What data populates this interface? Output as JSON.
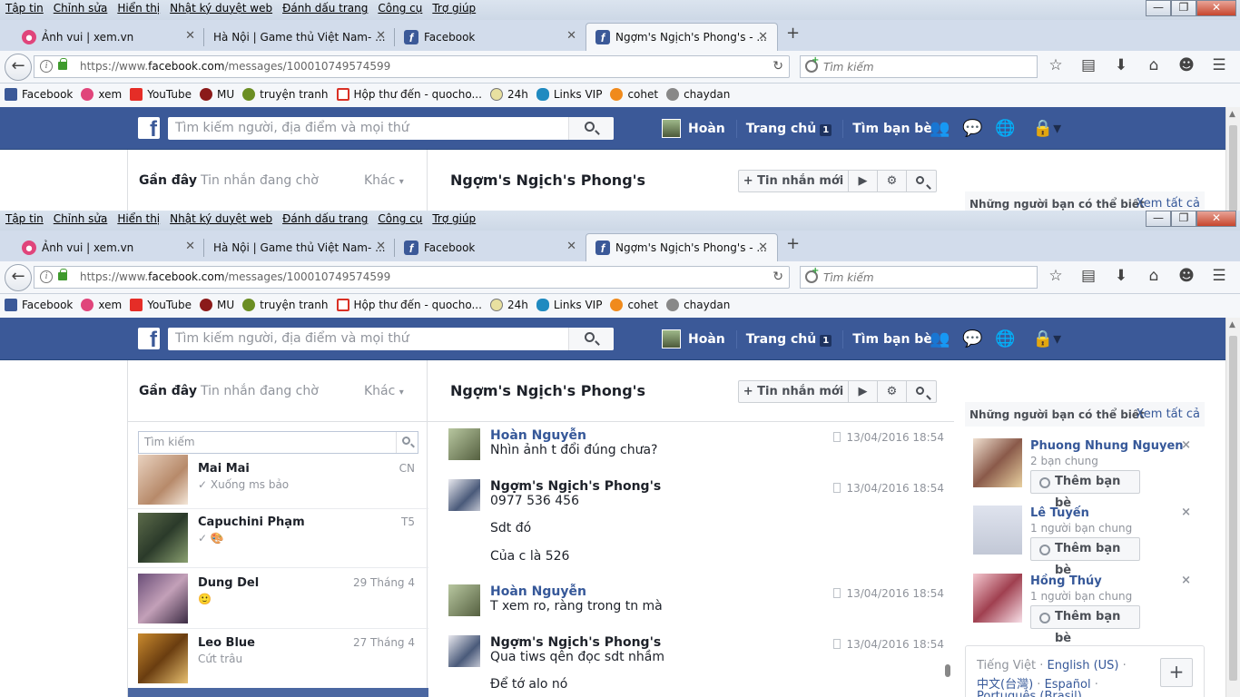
{
  "browser": {
    "menu": [
      "Tập tin",
      "Chỉnh sửa",
      "Hiển thị",
      "Nhật ký duyệt web",
      "Đánh dấu trang",
      "Công cụ",
      "Trợ giúp"
    ],
    "window_controls": {
      "minimize": "—",
      "maximize": "❐",
      "close": "✕"
    },
    "tabs": [
      {
        "label": "Ảnh vui | xem.vn",
        "icon": "xem-favicon",
        "active": false
      },
      {
        "label": "Hà Nội | Game thủ Việt Nam- ...",
        "icon": "none",
        "active": false
      },
      {
        "label": "Facebook",
        "icon": "facebook-favicon",
        "active": false
      },
      {
        "label": "Ngợm's Ngịch's Phong's - ...",
        "icon": "facebook-favicon",
        "active": true
      }
    ],
    "tab_close": "✕",
    "new_tab": "+",
    "url_prefix": "https://www.",
    "url_host": "facebook.com",
    "url_path": "/messages/100010749574599",
    "search_placeholder": "Tìm kiếm",
    "icon_glyphs": {
      "back": "←",
      "reload": "↻",
      "star": "☆",
      "library": "▤",
      "download": "⬇",
      "home": "⌂",
      "emoji": "☻",
      "menu": "☰",
      "fb": "f",
      "mag_fb": "",
      "video": "▶",
      "gear": "⚙"
    },
    "bookmarks": [
      {
        "label": "Facebook",
        "icon": "i-fb"
      },
      {
        "label": "xem",
        "icon": "i-xem"
      },
      {
        "label": "YouTube",
        "icon": "i-yt"
      },
      {
        "label": "MU",
        "icon": "i-mu"
      },
      {
        "label": "truyện tranh",
        "icon": "i-tt"
      },
      {
        "label": "Hộp thư đến - quocho...",
        "icon": "i-gm"
      },
      {
        "label": "24h",
        "icon": "i-24"
      },
      {
        "label": "Links VIP",
        "icon": "i-vip"
      },
      {
        "label": "cohet",
        "icon": "i-co"
      },
      {
        "label": "chaydan",
        "icon": "i-cd"
      }
    ]
  },
  "facebook": {
    "search_placeholder": "Tìm kiếm người, địa điểm và mọi thứ",
    "user_name": "Hoàn",
    "home_label": "Trang chủ",
    "home_badge": "1",
    "find_friends": "Tìm bạn bè",
    "nav_icons": {
      "friends": "👥",
      "messages": "💬",
      "notifications": "🌐",
      "privacy": "🔒▾"
    },
    "colors": {
      "brand": "#3b5998",
      "link": "#365899"
    }
  },
  "messenger": {
    "tab_recent": "Gần đây",
    "tab_pending": "Tin nhắn đang chờ",
    "tab_more": "Khác",
    "tab_more_caret": "▾",
    "search_placeholder": "Tìm kiếm",
    "threads": [
      {
        "name": "Mai Mai",
        "snippet": "✓ Xuống ms bảo",
        "time": "CN"
      },
      {
        "name": "Capuchini Phạm",
        "snippet": "✓ 🎨",
        "time": "T5"
      },
      {
        "name": "Dung Del",
        "snippet": "🙂",
        "time": "29 Tháng 4"
      },
      {
        "name": "Leo Blue",
        "snippet": "Cứt trâu",
        "time": "27 Tháng 4"
      }
    ],
    "conversation_title": "Ngợm's Ngịch's Phong's",
    "new_message": "+ Tin nhắn mới",
    "messages": [
      {
        "sender": "Hoàn Nguyễn",
        "time": "13/04/2016 18:54",
        "lines": [
          "Nhìn ảnh t đổi đúng chưa?"
        ]
      },
      {
        "sender": "Ngợm's Ngịch's Phong's",
        "time": "13/04/2016 18:54",
        "lines": [
          "0977 536 456",
          "Sdt đó",
          "Của c là 526"
        ]
      },
      {
        "sender": "Hoàn Nguyễn",
        "time": "13/04/2016 18:54",
        "lines": [
          "T xem ro, ràng trong tn mà"
        ]
      },
      {
        "sender": "Ngợm's Ngịch's Phong's",
        "time": "13/04/2016 18:54",
        "lines": [
          "Qua tiws qên đọc sdt nhầm",
          "Để tớ alo nó"
        ]
      }
    ]
  },
  "suggestions": {
    "title": "Những người bạn có thể biết",
    "see_all": "Xem tất cả",
    "add_label": "Thêm bạn bè",
    "dismiss": "×",
    "people": [
      {
        "name": "Phuong Nhung Nguyen",
        "mutual": "2 bạn chung"
      },
      {
        "name": "Lê Tuyến",
        "mutual": "1 người bạn chung"
      },
      {
        "name": "Hồng Thúy",
        "mutual": "1 người bạn chung"
      }
    ]
  },
  "languages": {
    "current": "Tiếng Việt",
    "sep": " · ",
    "others": [
      "English (US)",
      "中文(台灣)",
      "Español",
      "Português (Brasil)"
    ],
    "add": "+"
  }
}
